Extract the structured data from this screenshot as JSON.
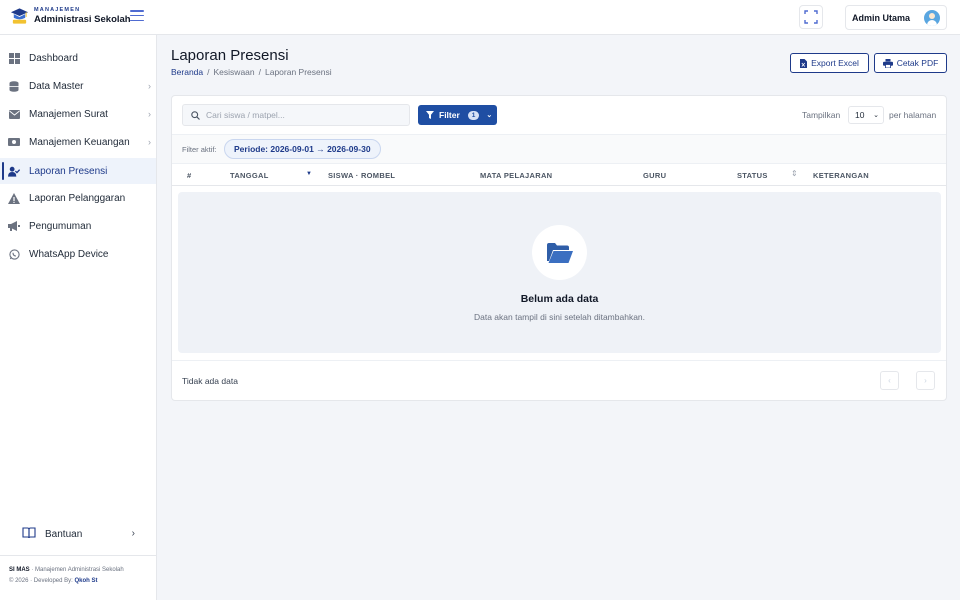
{
  "brand": {
    "small": "MANAJEMEN",
    "title": "Administrasi Sekolah"
  },
  "user": {
    "name": "Admin Utama"
  },
  "sidebar": {
    "items": [
      {
        "label": "Dashboard",
        "icon": "dashboard-grid-icon",
        "has_children": false
      },
      {
        "label": "Data Master",
        "icon": "database-icon",
        "has_children": true
      },
      {
        "label": "Manajemen Surat",
        "icon": "envelope-icon",
        "has_children": true
      },
      {
        "label": "Manajemen Keuangan",
        "icon": "money-icon",
        "has_children": true
      },
      {
        "label": "Laporan Presensi",
        "icon": "user-check-icon",
        "has_children": false,
        "active": true
      },
      {
        "label": "Laporan Pelanggaran",
        "icon": "warning-icon",
        "has_children": false
      },
      {
        "label": "Pengumuman",
        "icon": "megaphone-icon",
        "has_children": false
      },
      {
        "label": "WhatsApp Device",
        "icon": "whatsapp-icon",
        "has_children": false
      }
    ],
    "help_label": "Bantuan",
    "footer": {
      "app_short": "SI MAS",
      "app_desc": "· Manajemen Administrasi Sekolah",
      "copyright": "© 2026 · Developed By:",
      "developer": "Qkoh St"
    }
  },
  "page": {
    "title": "Laporan Presensi",
    "breadcrumb": [
      "Beranda",
      "Kesiswaan",
      "Laporan Presensi"
    ],
    "export_excel_label": "Export Excel",
    "print_pdf_label": "Cetak PDF"
  },
  "toolbar": {
    "search_placeholder": "Cari siswa / matpel...",
    "filter_label": "Filter",
    "filter_count": "1",
    "show_label": "Tampilkan",
    "per_page_value": "10",
    "per_page_suffix": "per halaman"
  },
  "active_filter": {
    "label": "Filter aktif:",
    "chip": "Periode: 2026-09-01 → 2026-09-30"
  },
  "table": {
    "columns": [
      "#",
      "TANGGAL",
      "SISWA · ROMBEL",
      "MATA PELAJARAN",
      "GURU",
      "STATUS",
      "KETERANGAN"
    ],
    "rows": []
  },
  "empty_state": {
    "title": "Belum ada data",
    "subtitle": "Data akan tampil di sini setelah ditambahkan.",
    "icon": "folder-open-icon"
  },
  "pagination": {
    "summary": "Tidak ada data"
  },
  "colors": {
    "primary": "#1f4ea3",
    "accent": "#1e3a8a",
    "background": "#f3f5f9"
  }
}
